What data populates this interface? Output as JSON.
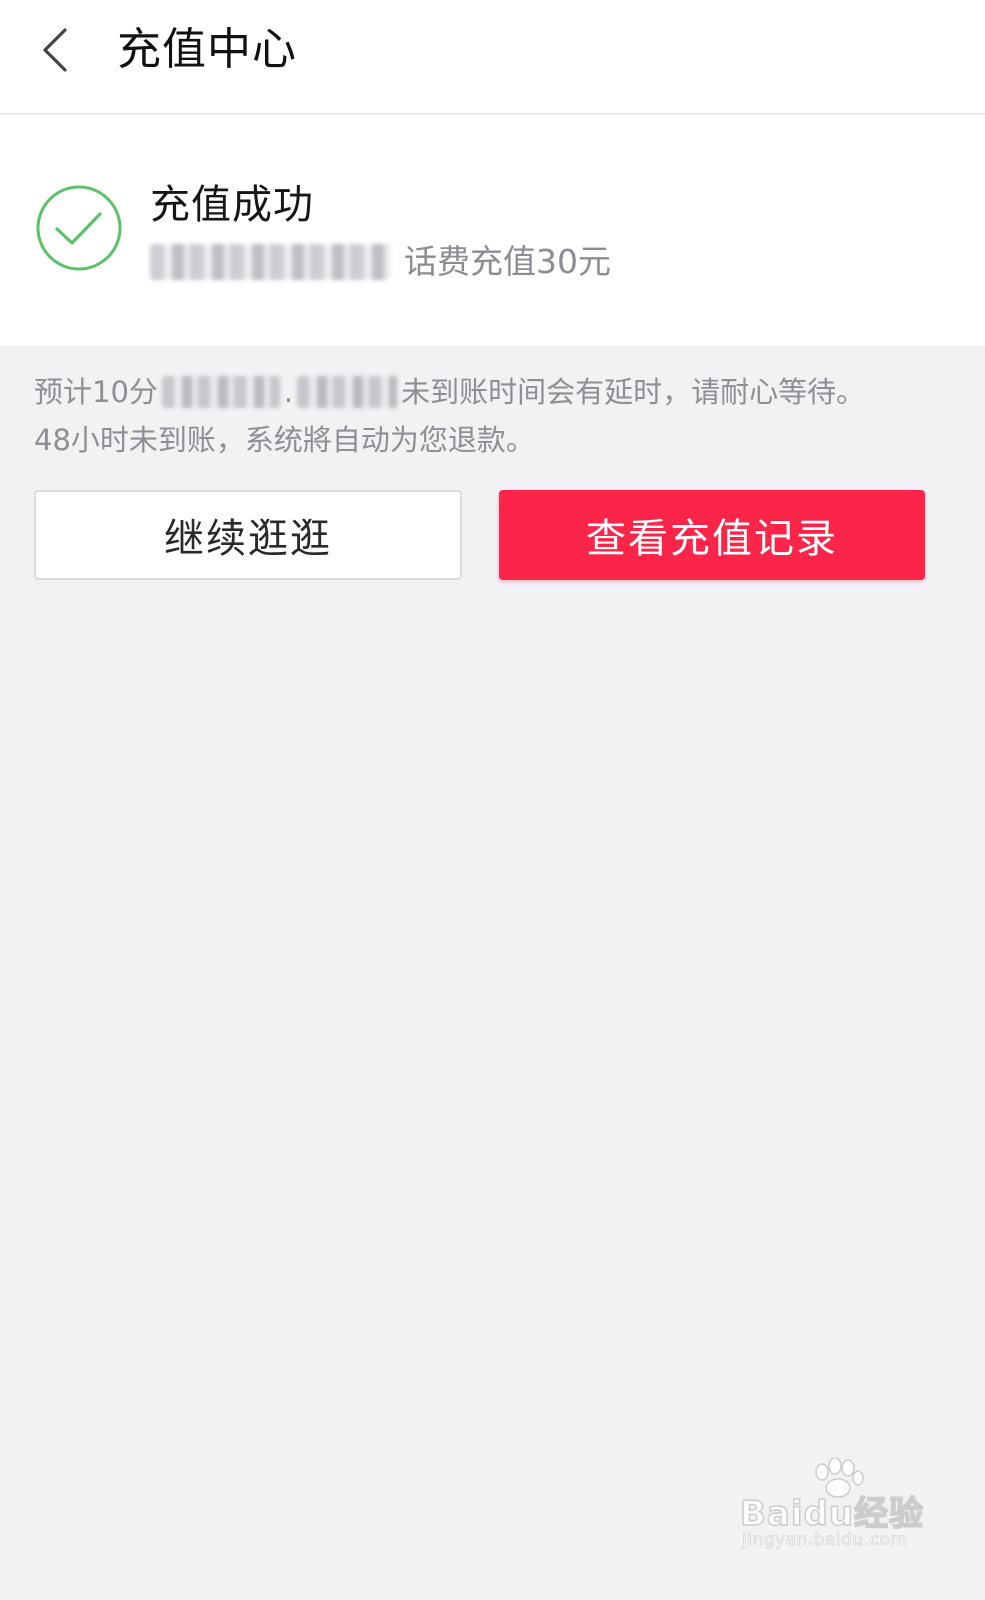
{
  "header": {
    "title": "充值中心",
    "back_icon": "chevron-left-icon"
  },
  "result": {
    "status_icon": "check-circle-icon",
    "title": "充值成功",
    "detail": "话费充值30元"
  },
  "notice": {
    "line1_prefix": "预计10分",
    "line1_suffix": "未到账时间会有延时，请耐心等待。",
    "line2": "48小时未到账，系统將自动为您退款。"
  },
  "actions": {
    "continue_label": "继续逛逛",
    "records_label": "查看充值记录"
  },
  "watermark": {
    "brand": "Baidu经验",
    "url": "jingyan.baidu.com"
  },
  "colors": {
    "accent_red": "#fb2449",
    "success_green": "#5cc26a",
    "page_bg": "#f2f2f4"
  }
}
